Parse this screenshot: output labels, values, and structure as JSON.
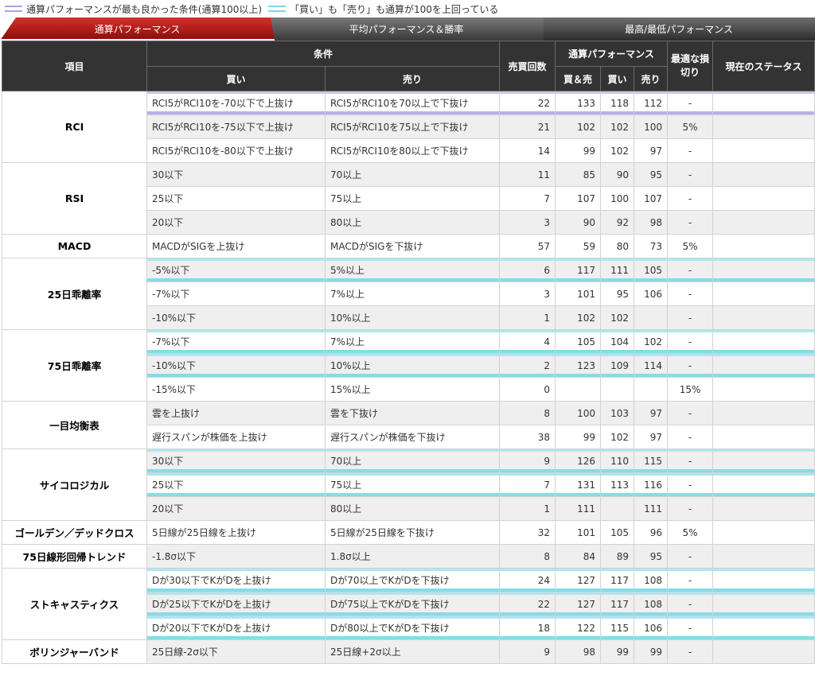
{
  "legend": {
    "purple_label": "通算パフォーマンスが最も良かった条件(通算100以上)",
    "cyan_label": "「買い」も「売り」も通算が100を上回っている",
    "purple_color": "#a8a4e0",
    "cyan_color": "#7fd6e3"
  },
  "tabs": [
    "通算パフォーマンス",
    "平均パフォーマンス＆勝率",
    "最高/最低パフォーマンス"
  ],
  "header": {
    "item": "項目",
    "condition": "条件",
    "buy": "買い",
    "sell": "売り",
    "count": "売買回数",
    "perf": "通算パフォーマンス",
    "perf_both": "買＆売",
    "perf_buy": "買い",
    "perf_sell": "売り",
    "stop_loss": "最適な損切り",
    "status": "現在のステータス"
  },
  "groups": [
    {
      "name": "RCI",
      "rows": [
        {
          "buy": "RCI5がRCI10を-70以下で上抜け",
          "sell": "RCI5がRCI10を70以上で下抜け",
          "count": "22",
          "both": "133",
          "pbuy": "118",
          "psell": "112",
          "stop": "-",
          "hl": "purple"
        },
        {
          "buy": "RCI5がRCI10を-75以下で上抜け",
          "sell": "RCI5がRCI10を75以上で下抜け",
          "count": "21",
          "both": "102",
          "pbuy": "102",
          "psell": "100",
          "stop": "5%",
          "hl": ""
        },
        {
          "buy": "RCI5がRCI10を-80以下で上抜け",
          "sell": "RCI5がRCI10を80以上で下抜け",
          "count": "14",
          "both": "99",
          "pbuy": "102",
          "psell": "97",
          "stop": "-",
          "hl": ""
        }
      ]
    },
    {
      "name": "RSI",
      "rows": [
        {
          "buy": "30以下",
          "sell": "70以上",
          "count": "11",
          "both": "85",
          "pbuy": "90",
          "psell": "95",
          "stop": "-",
          "hl": ""
        },
        {
          "buy": "25以下",
          "sell": "75以上",
          "count": "7",
          "both": "107",
          "pbuy": "100",
          "psell": "107",
          "stop": "-",
          "hl": ""
        },
        {
          "buy": "20以下",
          "sell": "80以上",
          "count": "3",
          "both": "90",
          "pbuy": "92",
          "psell": "98",
          "stop": "-",
          "hl": ""
        }
      ]
    },
    {
      "name": "MACD",
      "rows": [
        {
          "buy": "MACDがSIGを上抜け",
          "sell": "MACDがSIGを下抜け",
          "count": "57",
          "both": "59",
          "pbuy": "80",
          "psell": "73",
          "stop": "5%",
          "hl": ""
        }
      ]
    },
    {
      "name": "25日乖離率",
      "rows": [
        {
          "buy": "-5%以下",
          "sell": "5%以上",
          "count": "6",
          "both": "117",
          "pbuy": "111",
          "psell": "105",
          "stop": "-",
          "hl": "cyan"
        },
        {
          "buy": "-7%以下",
          "sell": "7%以上",
          "count": "3",
          "both": "101",
          "pbuy": "95",
          "psell": "106",
          "stop": "-",
          "hl": ""
        },
        {
          "buy": "-10%以下",
          "sell": "10%以上",
          "count": "1",
          "both": "102",
          "pbuy": "102",
          "psell": "",
          "stop": "-",
          "hl": ""
        }
      ]
    },
    {
      "name": "75日乖離率",
      "rows": [
        {
          "buy": "-7%以下",
          "sell": "7%以上",
          "count": "4",
          "both": "105",
          "pbuy": "104",
          "psell": "102",
          "stop": "-",
          "hl": "cyan"
        },
        {
          "buy": "-10%以下",
          "sell": "10%以上",
          "count": "2",
          "both": "123",
          "pbuy": "109",
          "psell": "114",
          "stop": "-",
          "hl": "cyan"
        },
        {
          "buy": "-15%以下",
          "sell": "15%以上",
          "count": "0",
          "both": "",
          "pbuy": "",
          "psell": "",
          "stop": "15%",
          "hl": ""
        }
      ]
    },
    {
      "name": "一目均衡表",
      "rows": [
        {
          "buy": "雲を上抜け",
          "sell": "雲を下抜け",
          "count": "8",
          "both": "100",
          "pbuy": "103",
          "psell": "97",
          "stop": "-",
          "hl": ""
        },
        {
          "buy": "遅行スパンが株価を上抜け",
          "sell": "遅行スパンが株価を下抜け",
          "count": "38",
          "both": "99",
          "pbuy": "102",
          "psell": "97",
          "stop": "-",
          "hl": ""
        }
      ]
    },
    {
      "name": "サイコロジカル",
      "rows": [
        {
          "buy": "30以下",
          "sell": "70以上",
          "count": "9",
          "both": "126",
          "pbuy": "110",
          "psell": "115",
          "stop": "-",
          "hl": "cyan"
        },
        {
          "buy": "25以下",
          "sell": "75以上",
          "count": "7",
          "both": "131",
          "pbuy": "113",
          "psell": "116",
          "stop": "-",
          "hl": "cyan"
        },
        {
          "buy": "20以下",
          "sell": "80以上",
          "count": "1",
          "both": "111",
          "pbuy": "",
          "psell": "111",
          "stop": "-",
          "hl": ""
        }
      ]
    },
    {
      "name": "ゴールデン／デッドクロス",
      "rows": [
        {
          "buy": "5日線が25日線を上抜け",
          "sell": "5日線が25日線を下抜け",
          "count": "32",
          "both": "101",
          "pbuy": "105",
          "psell": "96",
          "stop": "5%",
          "hl": ""
        }
      ]
    },
    {
      "name": "75日線形回帰トレンド",
      "rows": [
        {
          "buy": "-1.8σ以下",
          "sell": "1.8σ以上",
          "count": "8",
          "both": "84",
          "pbuy": "89",
          "psell": "95",
          "stop": "-",
          "hl": ""
        }
      ]
    },
    {
      "name": "ストキャスティクス",
      "rows": [
        {
          "buy": "Dが30以下でKがDを上抜け",
          "sell": "Dが70以上でKがDを下抜け",
          "count": "24",
          "both": "127",
          "pbuy": "117",
          "psell": "108",
          "stop": "-",
          "hl": "cyan"
        },
        {
          "buy": "Dが25以下でKがDを上抜け",
          "sell": "Dが75以上でKがDを下抜け",
          "count": "22",
          "both": "127",
          "pbuy": "117",
          "psell": "108",
          "stop": "-",
          "hl": "cyan"
        },
        {
          "buy": "Dが20以下でKがDを上抜け",
          "sell": "Dが80以上でKがDを下抜け",
          "count": "18",
          "both": "122",
          "pbuy": "115",
          "psell": "106",
          "stop": "-",
          "hl": "cyan"
        }
      ]
    },
    {
      "name": "ボリンジャーバンド",
      "rows": [
        {
          "buy": "25日線-2σ以下",
          "sell": "25日線+2σ以上",
          "count": "9",
          "both": "98",
          "pbuy": "99",
          "psell": "99",
          "stop": "-",
          "hl": ""
        }
      ]
    }
  ]
}
